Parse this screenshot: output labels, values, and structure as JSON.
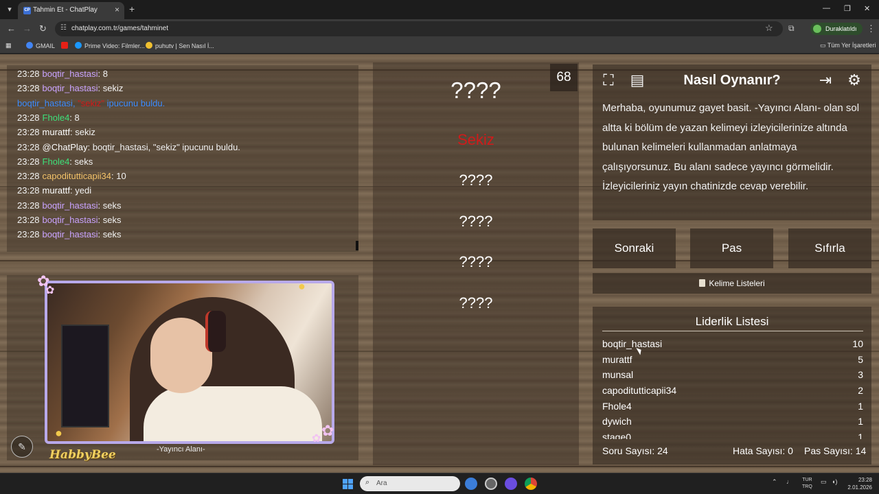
{
  "browser": {
    "tab_title": "Tahmin Et - ChatPlay",
    "tab_favicon": "CP",
    "url": "chatplay.com.tr/games/tahminet",
    "profile_label": "Duraklatıldı",
    "bookmarks": [
      "GMAIL",
      "Prime Video: Filmler...",
      "puhutv | Sen Nasıl İ..."
    ],
    "all_bookmarks": "Tüm Yer İşaretleri"
  },
  "chat": {
    "messages": [
      {
        "time": "23:28",
        "user": "boqtir_hastasi",
        "text": ": 8",
        "color": "#c9a3ff"
      },
      {
        "time": "23:28",
        "user": "boqtir_hastasi",
        "text": ": sekiz",
        "color": "#c9a3ff"
      },
      {
        "time": "",
        "user": "boqtir_hastasi",
        "text": ", \"sekiz\" ipucunu buldu.",
        "color": "#3c8cff",
        "highlight": "\"sekiz\""
      },
      {
        "time": "23:28",
        "user": "Fhole4",
        "text": ": 8",
        "color": "#3de07a"
      },
      {
        "time": "23:28",
        "user": "murattf",
        "text": ": sekiz",
        "color": "#ffffff"
      },
      {
        "time": "23:28",
        "user": "@ChatPlay",
        "text": ": boqtir_hastasi, \"sekiz\" ipucunu buldu.",
        "color": "#ffffff"
      },
      {
        "time": "23:28",
        "user": "Fhole4",
        "text": ": seks",
        "color": "#3de07a"
      },
      {
        "time": "23:28",
        "user": "capoditutticapii34",
        "text": ": 10",
        "color": "#f5c46a"
      },
      {
        "time": "23:28",
        "user": "murattf",
        "text": ": yedi",
        "color": "#ffffff"
      },
      {
        "time": "23:28",
        "user": "boqtir_hastasi",
        "text": ": seks",
        "color": "#c9a3ff"
      },
      {
        "time": "23:28",
        "user": "boqtir_hastasi",
        "text": ": seks",
        "color": "#c9a3ff"
      },
      {
        "time": "23:28",
        "user": "boqtir_hastasi",
        "text": ": seks",
        "color": "#c9a3ff"
      }
    ]
  },
  "streamer": {
    "label": "-Yayıncı Alanı-",
    "brand": "HabbyBee"
  },
  "game": {
    "timer": "68",
    "main_word": "????",
    "found_word": "Sekiz",
    "hidden_words": [
      "????",
      "????",
      "????",
      "????"
    ]
  },
  "howto": {
    "title": "Nasıl Oynanır?",
    "text": "Merhaba, oyunumuz gayet basit. -Yayıncı Alanı- olan sol altta ki bölüm de yazan kelimeyi izleyicilerinize altında bulunan kelimeleri kullanmadan anlatmaya çalışıyorsunuz. Bu alanı sadece yayıncı görmelidir. İzleyicileriniz yayın chatinizde cevap verebilir."
  },
  "controls": {
    "next": "Sonraki",
    "pass": "Pas",
    "reset": "Sıfırla",
    "word_lists": "Kelime Listeleri"
  },
  "leaderboard": {
    "title": "Liderlik Listesi",
    "rows": [
      {
        "name": "boqtir_hastasi",
        "score": "10"
      },
      {
        "name": "murattf",
        "score": "5"
      },
      {
        "name": "munsal",
        "score": "3"
      },
      {
        "name": "capoditutticapii34",
        "score": "2"
      },
      {
        "name": "Fhole4",
        "score": "1"
      },
      {
        "name": "dywich",
        "score": "1"
      },
      {
        "name": "stage0",
        "score": "1"
      }
    ],
    "question_count": "Soru Sayısı: 24",
    "error_count": "Hata Sayısı: 0",
    "pass_count": "Pas Sayısı: 14"
  },
  "taskbar": {
    "search_placeholder": "Ara",
    "lang_top": "TUR",
    "lang_bottom": "TRQ",
    "time": "23:28",
    "date": "2.01.2026"
  }
}
